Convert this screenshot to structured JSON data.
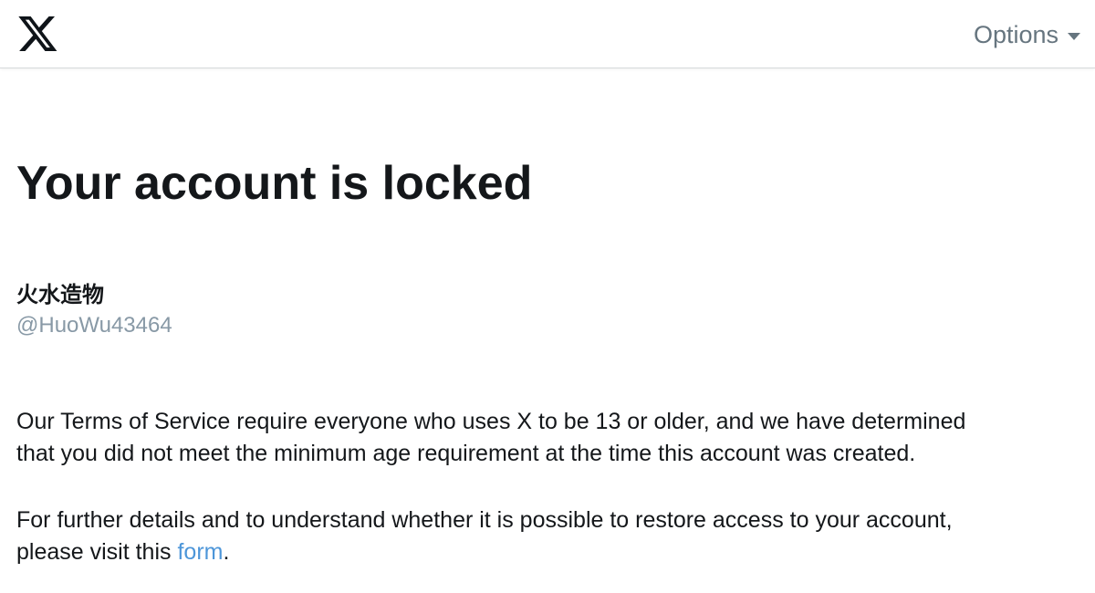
{
  "header": {
    "logo_icon": "x-logo-icon",
    "options_label": "Options",
    "options_icon": "caret-down-icon"
  },
  "main": {
    "title": "Your account is locked",
    "display_name": "火水造物",
    "handle": "@HuoWu43464",
    "paragraph1_line1": "Our Terms of Service require everyone who uses X to be 13 or older, and we have determined",
    "paragraph1_line2": "that you did not meet the minimum age requirement at the time this account was created.",
    "paragraph2_line1": "For further details and to understand whether it is possible to restore access to your account,",
    "paragraph2_line2_prefix": "please visit this ",
    "paragraph2_link": "form",
    "paragraph2_suffix": "."
  },
  "colors": {
    "text": "#14171a",
    "muted": "#66757f",
    "handle": "#8899a6",
    "link": "#4d96d9",
    "border": "#d6d9db"
  }
}
